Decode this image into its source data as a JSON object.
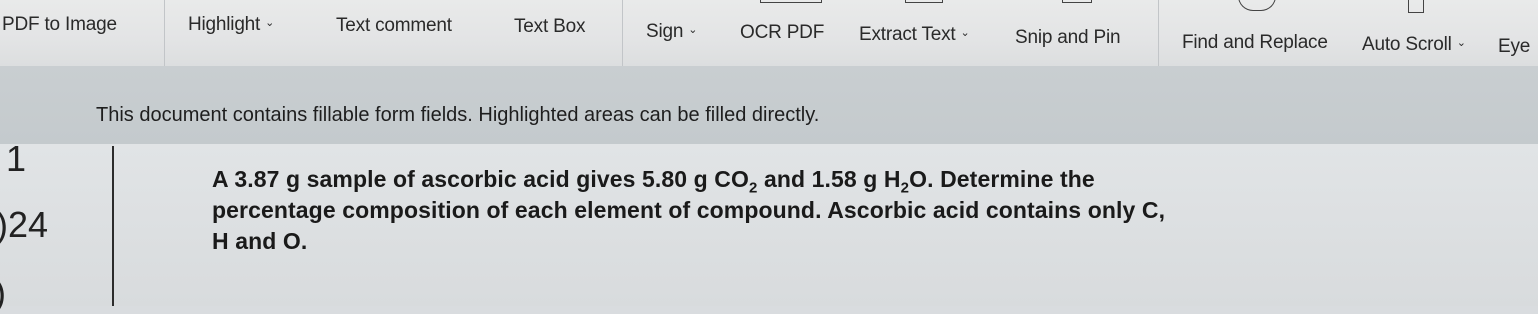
{
  "toolbar": {
    "items": [
      {
        "label": "PDF to Image"
      },
      {
        "label": "Highlight"
      },
      {
        "label": "Text comment"
      },
      {
        "label": "Text Box"
      },
      {
        "label": "Sign"
      },
      {
        "label": "OCR PDF"
      },
      {
        "label": "Extract Text"
      },
      {
        "label": "Snip and Pin"
      },
      {
        "label": "Find and Replace"
      },
      {
        "label": "Auto Scroll"
      },
      {
        "label": "Eye"
      }
    ]
  },
  "infobar": {
    "message": "This document contains fillable form fields. Highlighted areas can be filled directly."
  },
  "document": {
    "margin_numbers": [
      "1",
      ")24",
      ")"
    ],
    "question": {
      "line1_a": "A 3.87 g sample of ascorbic acid gives 5.80 g CO",
      "line1_sub1": "2",
      "line1_b": " and 1.58 g H",
      "line1_sub2": "2",
      "line1_c": "O. Determine the",
      "line2": "percentage composition of each element of compound. Ascorbic acid contains only C,",
      "line3": "H and O."
    }
  }
}
